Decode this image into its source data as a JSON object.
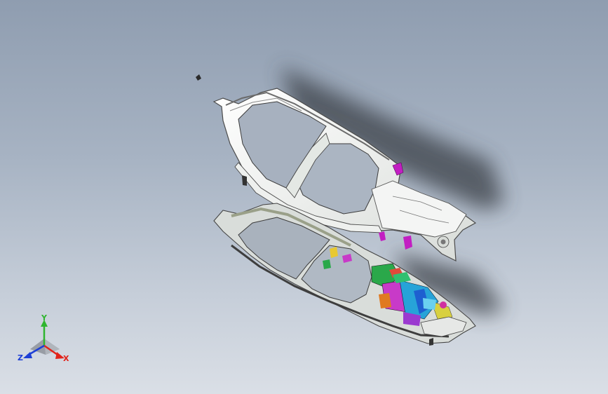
{
  "window": {
    "view": "isometric"
  },
  "model": {
    "upper_part": "side-frame-upper",
    "lower_part": "side-frame-lower"
  },
  "triad": {
    "x_label": "X",
    "y_label": "Y",
    "z_label": "Z",
    "colors": {
      "x": "#e2231a",
      "y": "#2fb52f",
      "z": "#1d3fd6"
    }
  }
}
